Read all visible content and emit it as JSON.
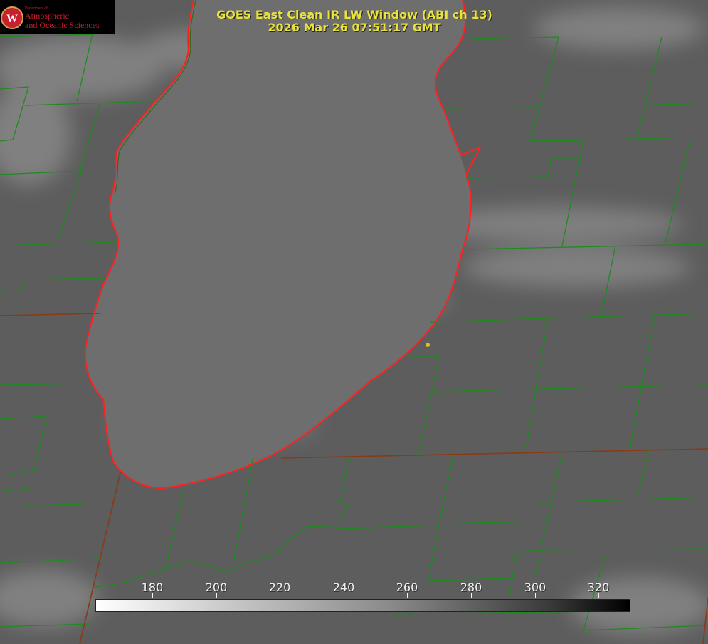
{
  "title": {
    "line1": "GOES East Clean IR LW Window (ABI ch 13)",
    "line2": "2026 Mar 26 07:51:17 GMT"
  },
  "logo": {
    "department_text": "Department of",
    "line1": "Atmospheric",
    "line2": "and Oceanic Sciences",
    "shield_letter": "W",
    "brand_color": "#c51f30"
  },
  "map_colors": {
    "county_lines": "#1f8a1f",
    "state_lines": "#8a3a14",
    "lake_shoreline": "#ff2020",
    "marker": "#d6c21a",
    "title_text": "#e8e23c"
  },
  "colorbar": {
    "ticks": [
      "180",
      "200",
      "220",
      "240",
      "260",
      "280",
      "300",
      "320"
    ],
    "scale": "light (cold) to dark (warm) grayscale"
  }
}
